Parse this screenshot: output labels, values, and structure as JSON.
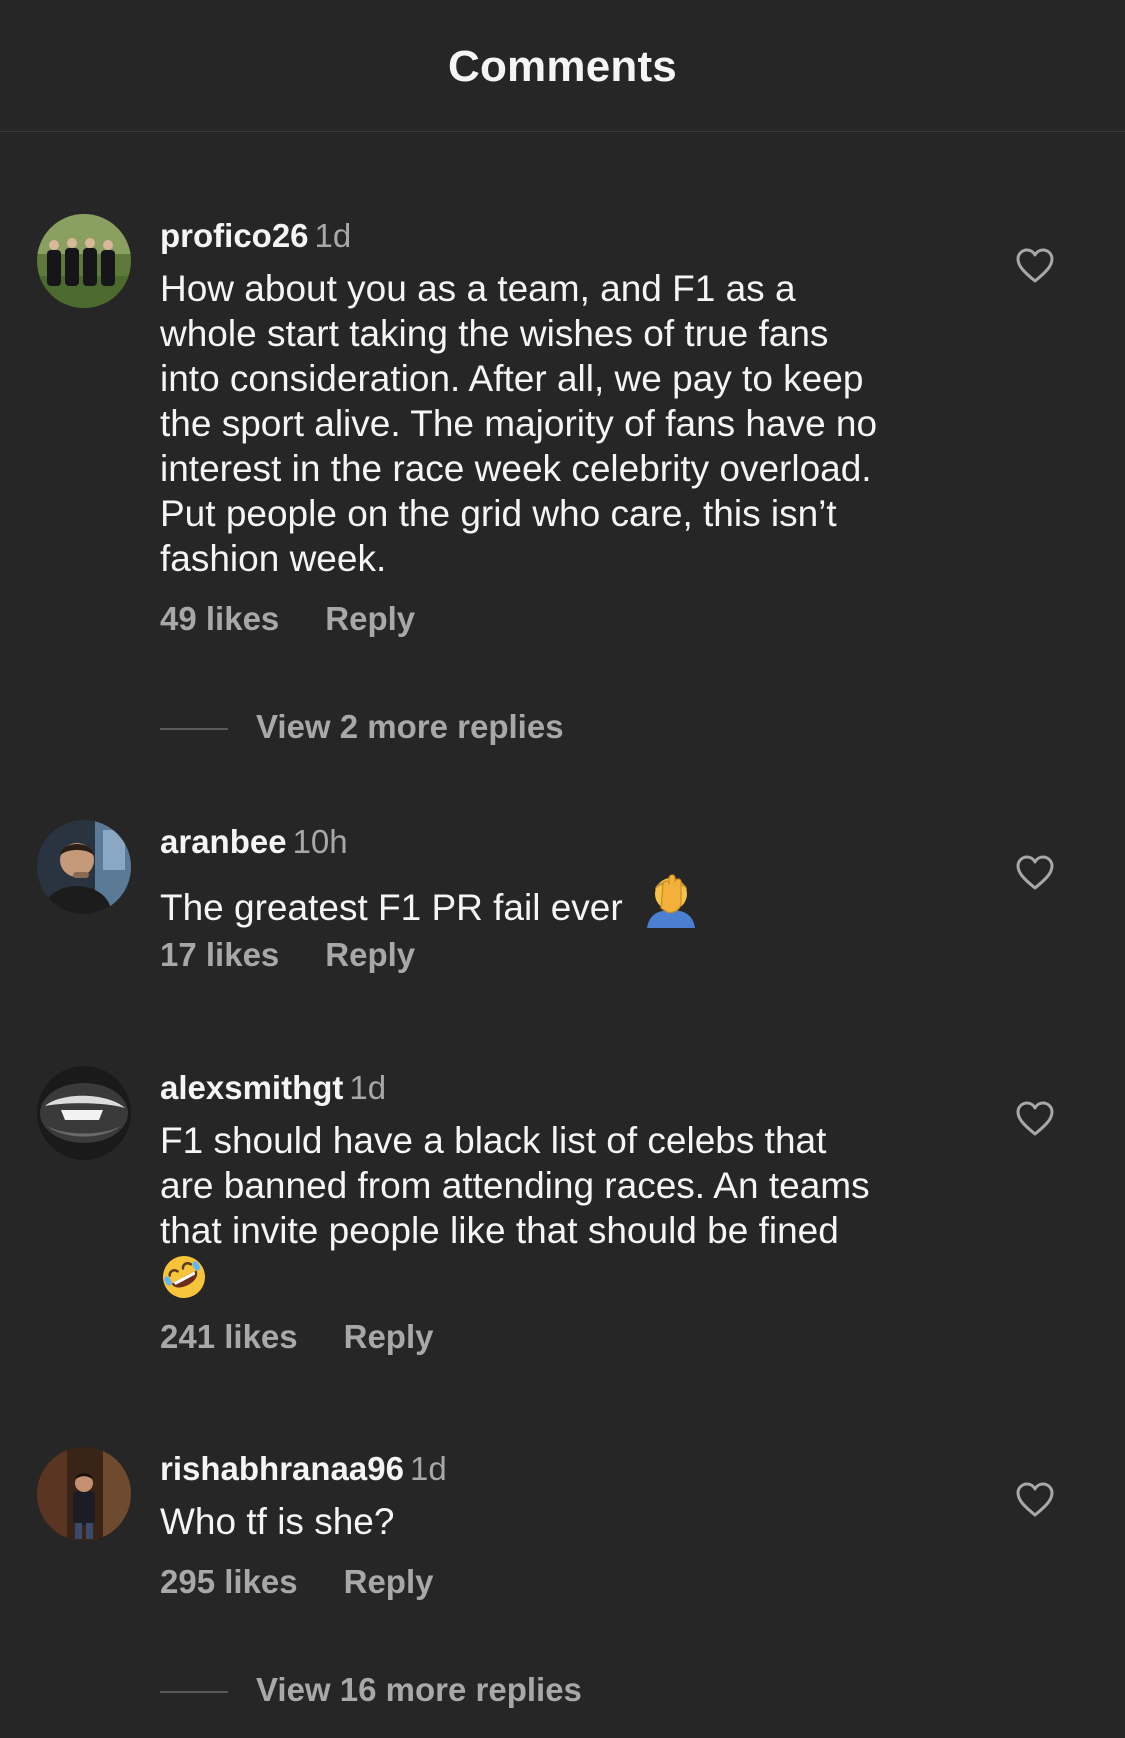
{
  "header": {
    "title": "Comments"
  },
  "comments": [
    {
      "username": "profico26",
      "time": "1d",
      "lines": [
        "How about you as a team, and F1 as a",
        "whole start taking the wishes of true fans",
        "into consideration. After all, we pay to keep",
        "the sport alive. The majority of fans have no",
        "interest in the race week celebrity overload.",
        "Put people on the grid who care, this isn’t",
        "fashion week."
      ],
      "likes": "49 likes",
      "reply": "Reply",
      "view_replies": "View 2 more replies"
    },
    {
      "username": "aranbee",
      "time": "10h",
      "text": "The greatest F1 PR fail ever",
      "emoji": "face-palm",
      "likes": "17 likes",
      "reply": "Reply"
    },
    {
      "username": "alexsmithgt",
      "time": "1d",
      "lines": [
        "F1 should have a black list of celebs that",
        "are banned from attending races. An teams",
        "that invite people like that should be fined"
      ],
      "emoji": "rolling-on-the-floor-laughing",
      "likes": "241 likes",
      "reply": "Reply"
    },
    {
      "username": "rishabhranaa96",
      "time": "1d",
      "text": "Who tf is she?",
      "likes": "295 likes",
      "reply": "Reply",
      "view_replies": "View 16 more replies"
    }
  ],
  "colors": {
    "background": "#262626",
    "primary_text": "#f5f5f5",
    "secondary_text": "#a8a8a8"
  }
}
